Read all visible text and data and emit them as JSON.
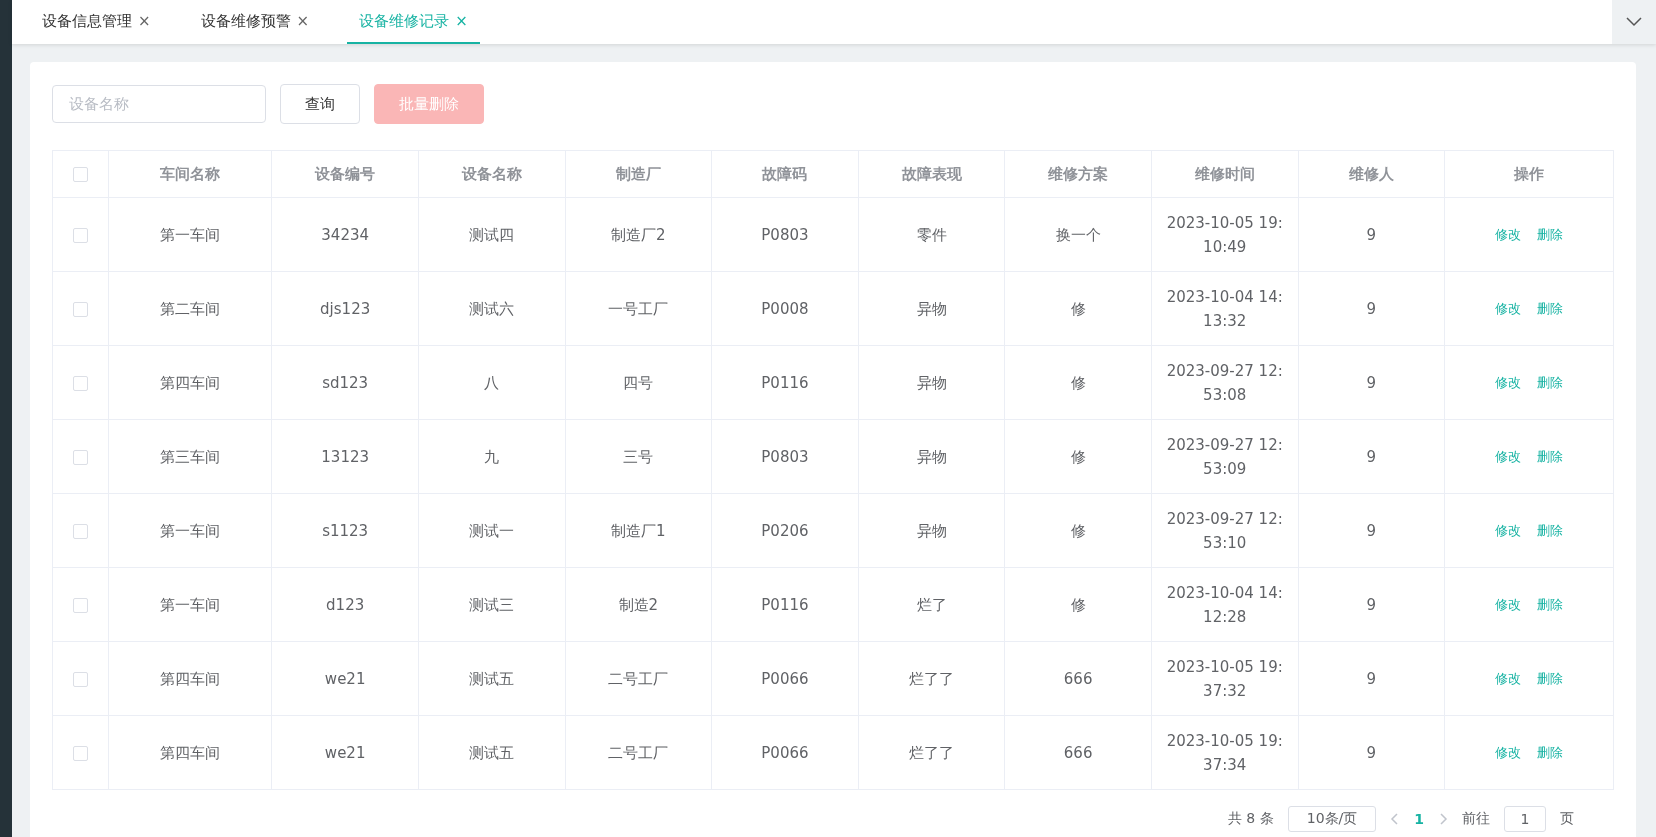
{
  "tabs": [
    {
      "label": "设备信息管理",
      "close": "×",
      "selected": false
    },
    {
      "label": "设备维修预警",
      "close": "×",
      "selected": false
    },
    {
      "label": "设备维修记录",
      "close": "×",
      "selected": true
    }
  ],
  "toolbar": {
    "search": {
      "placeholder": "设备名称"
    },
    "query_button": "查询",
    "batch_delete": {
      "label": "批量删除",
      "disabled": true
    }
  },
  "table": {
    "select_all": {
      "checked": false
    },
    "columns": [
      "车间名称",
      "设备编号",
      "设备名称",
      "制造厂",
      "故障码",
      "故障表现",
      "维修方案",
      "维修时间",
      "维修人",
      "操作"
    ],
    "rows": [
      {
        "checked": false,
        "cells": [
          "第一车间",
          "34234",
          "测试四",
          "制造厂2",
          "P0803",
          "零件",
          "换一个",
          "2023-10-05 19:10:49",
          "9"
        ],
        "actions": [
          "修改",
          "删除"
        ]
      },
      {
        "checked": false,
        "cells": [
          "第二车间",
          "djs123",
          "测试六",
          "一号工厂",
          "P0008",
          "异物",
          "修",
          "2023-10-04 14:13:32",
          "9"
        ],
        "actions": [
          "修改",
          "删除"
        ]
      },
      {
        "checked": false,
        "cells": [
          "第四车间",
          "sd123",
          "八",
          "四号",
          "P0116",
          "异物",
          "修",
          "2023-09-27 12:53:08",
          "9"
        ],
        "actions": [
          "修改",
          "删除"
        ]
      },
      {
        "checked": false,
        "cells": [
          "第三车间",
          "13123",
          "九",
          "三号",
          "P0803",
          "异物",
          "修",
          "2023-09-27 12:53:09",
          "9"
        ],
        "actions": [
          "修改",
          "删除"
        ]
      },
      {
        "checked": false,
        "cells": [
          "第一车间",
          "s1123",
          "测试一",
          "制造厂1",
          "P0206",
          "异物",
          "修",
          "2023-09-27 12:53:10",
          "9"
        ],
        "actions": [
          "修改",
          "删除"
        ]
      },
      {
        "checked": false,
        "cells": [
          "第一车间",
          "d123",
          "测试三",
          "制造2",
          "P0116",
          "烂了",
          "修",
          "2023-10-04 14:12:28",
          "9"
        ],
        "actions": [
          "修改",
          "删除"
        ]
      },
      {
        "checked": false,
        "cells": [
          "第四车间",
          "we21",
          "测试五",
          "二号工厂",
          "P0066",
          "烂了了",
          "666",
          "2023-10-05 19:37:32",
          "9"
        ],
        "actions": [
          "修改",
          "删除"
        ]
      },
      {
        "checked": false,
        "cells": [
          "第四车间",
          "we21",
          "测试五",
          "二号工厂",
          "P0066",
          "烂了了",
          "666",
          "2023-10-05 19:37:34",
          "9"
        ],
        "actions": [
          "修改",
          "删除"
        ]
      }
    ]
  },
  "pagination": {
    "total": "共 8 条",
    "page_size": "10条/页",
    "pages": [
      {
        "label": "1",
        "selected": true
      }
    ],
    "goto_label": "前往",
    "goto_value": "1",
    "goto_unit": "页"
  }
}
